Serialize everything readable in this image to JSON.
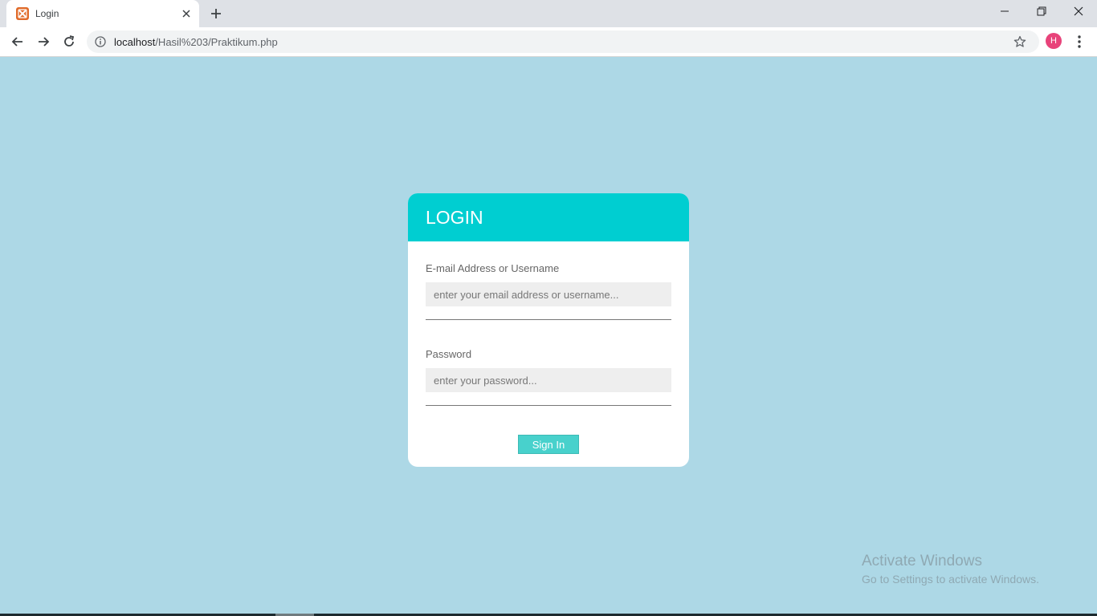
{
  "browser": {
    "tab_title": "Login",
    "url_host": "localhost",
    "url_path": "/Hasil%203/Praktikum.php",
    "profile_initial": "H",
    "icons": {
      "favicon": "xampp-icon",
      "tab_close": "close-icon",
      "new_tab": "plus-icon",
      "back": "back-arrow-icon",
      "forward": "forward-arrow-icon",
      "reload": "reload-icon",
      "site_info": "info-icon",
      "bookmark": "star-icon",
      "menu": "kebab-menu-icon",
      "minimize": "minimize-icon",
      "restore": "restore-icon",
      "window_close": "close-icon"
    }
  },
  "login": {
    "title": "LOGIN",
    "username_label": "E-mail Address or Username",
    "username_placeholder": "enter your email address or username...",
    "password_label": "Password",
    "password_placeholder": "enter your password...",
    "signin_label": "Sign In"
  },
  "watermark": {
    "title": "Activate Windows",
    "subtitle": "Go to Settings to activate Windows."
  },
  "colors": {
    "page_background": "#add8e6",
    "header_background": "#00ced1",
    "button_background": "#48d1cc",
    "input_background": "#eeeeee",
    "avatar_background": "#e8437a"
  }
}
